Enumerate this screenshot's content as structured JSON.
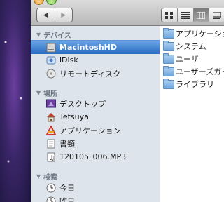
{
  "sidebar": {
    "sections": {
      "devices": "デバイス",
      "places": "場所",
      "search": "検索"
    },
    "devices": [
      "MacintoshHD",
      "iDisk",
      "リモートディスク"
    ],
    "places": [
      "デスクトップ",
      "Tetsuya",
      "アプリケーション",
      "書類",
      "120105_006.MP3"
    ],
    "search": [
      "今日",
      "昨日"
    ]
  },
  "content": {
    "items": [
      "アプリケーション",
      "システム",
      "ユーザ",
      "ユーザーズガイド",
      "ライブラリ"
    ]
  },
  "colors": {
    "selection": "#2a6bc4",
    "sidebar_bg": "#dde4ec",
    "section_text": "#6c7683",
    "folder_blue": "#6ea6dc"
  },
  "icons": {
    "back": "back-arrow-icon",
    "forward": "forward-arrow-icon",
    "view_icon": "icon-view-icon",
    "view_list": "list-view-icon",
    "view_column": "column-view-icon"
  }
}
